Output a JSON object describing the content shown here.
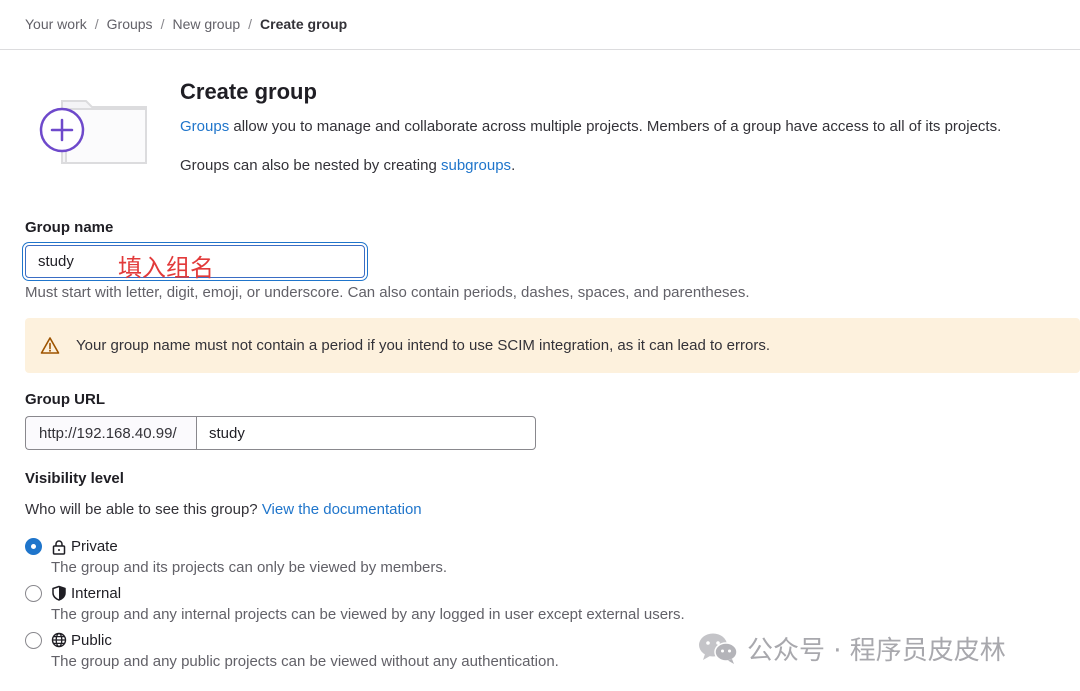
{
  "breadcrumb": {
    "items": [
      "Your work",
      "Groups",
      "New group"
    ],
    "current": "Create group",
    "separator": "/"
  },
  "header": {
    "title": "Create group",
    "intro_link": "Groups",
    "intro_text": " allow you to manage and collaborate across multiple projects. Members of a group have access to all of its projects.",
    "nested_text": "Groups can also be nested by creating ",
    "nested_link": "subgroups",
    "nested_end": "."
  },
  "form": {
    "group_name_label": "Group name",
    "group_name_value": "study",
    "annotation": "填入组名",
    "group_name_help": "Must start with letter, digit, emoji, or underscore. Can also contain periods, dashes, spaces, and parentheses.",
    "alert_text": "Your group name must not contain a period if you intend to use SCIM integration, as it can lead to errors.",
    "group_url_label": "Group URL",
    "url_prefix": "http://192.168.40.99/",
    "url_value": "study",
    "visibility_label": "Visibility level",
    "visibility_question": "Who will be able to see this group? ",
    "visibility_link": "View the documentation",
    "visibility_options": [
      {
        "label": "Private",
        "icon": "lock-icon",
        "selected": true,
        "description": "The group and its projects can only be viewed by members."
      },
      {
        "label": "Internal",
        "icon": "shield-icon",
        "selected": false,
        "description": "The group and any internal projects can be viewed by any logged in user except external users."
      },
      {
        "label": "Public",
        "icon": "globe-icon",
        "selected": false,
        "description": "The group and any public projects can be viewed without any authentication."
      }
    ]
  },
  "watermark": {
    "text": "公众号 · 程序员皮皮林",
    "icon": "wechat-icon"
  },
  "colors": {
    "link": "#1f75cb",
    "alert_bg": "#fdf1dd",
    "annotation": "#e23a3a",
    "illustration_accent": "#6e49cb"
  }
}
